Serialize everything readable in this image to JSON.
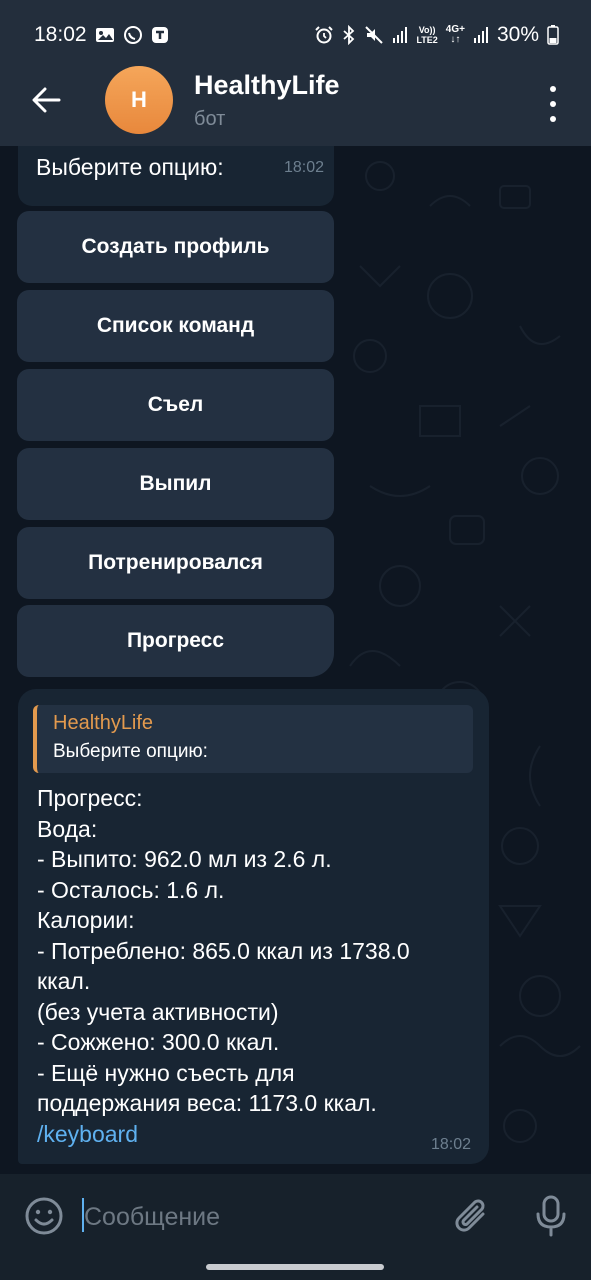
{
  "status_bar": {
    "time": "18:02",
    "battery_text": "30%",
    "network_badge_top": "Vo))",
    "network_badge_bottom": "LTE2",
    "network_4g": "4G+"
  },
  "header": {
    "avatar_letter": "H",
    "title": "HealthyLife",
    "subtitle": "бот"
  },
  "previous_message": {
    "text": "Выберите опцию:",
    "time": "18:02"
  },
  "keyboard": {
    "buttons": [
      "Создать профиль",
      "Список команд",
      "Съел",
      "Выпил",
      "Потренировался",
      "Прогресс"
    ]
  },
  "message": {
    "reply_name": "HealthyLife",
    "reply_text": "Выберите опцию:",
    "lines": [
      "Прогресс:",
      "Вода:",
      "- Выпито: 962.0 мл из 2.6 л.",
      "- Осталось: 1.6 л.",
      "Калории:",
      "- Потреблено: 865.0 ккал из 1738.0",
      "ккал.",
      "(без учета активности)",
      "- Сожжено: 300.0 ккал.",
      "- Ещё нужно съесть для",
      "поддержания веса: 1173.0 ккал."
    ],
    "link": "/keyboard",
    "time": "18:02"
  },
  "input": {
    "placeholder": "Сообщение",
    "value": ""
  },
  "colors": {
    "header_bg": "#232e3c",
    "chat_bg": "#0e1621",
    "bubble_bg": "#182533",
    "keyboard_button_bg": "#233041",
    "accent_orange": "#e39a4e",
    "link_blue": "#5fb1f0"
  },
  "icons": {
    "back": "arrow-left-icon",
    "menu": "more-vertical-icon",
    "emoji": "emoji-icon",
    "attach": "paperclip-icon",
    "mic": "microphone-icon"
  }
}
